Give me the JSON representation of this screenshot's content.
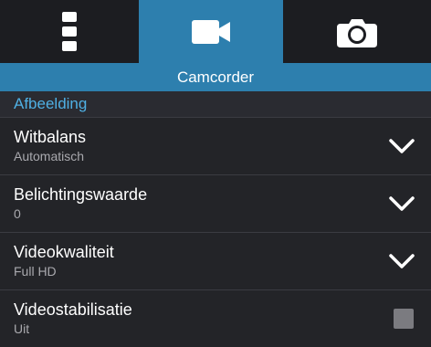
{
  "tabs": [
    {
      "name": "menu-more-icon",
      "active": false
    },
    {
      "name": "video-camera-icon",
      "active": true
    },
    {
      "name": "camera-icon",
      "active": false
    }
  ],
  "title": "Camcorder",
  "section": "Afbeelding",
  "rows": [
    {
      "label": "Witbalans",
      "value": "Automatisch",
      "control": "chevron"
    },
    {
      "label": "Belichtingswaarde",
      "value": "0",
      "control": "chevron"
    },
    {
      "label": "Videokwaliteit",
      "value": "Full HD",
      "control": "chevron"
    },
    {
      "label": "Videostabilisatie",
      "value": "Uit",
      "control": "checkbox"
    }
  ]
}
